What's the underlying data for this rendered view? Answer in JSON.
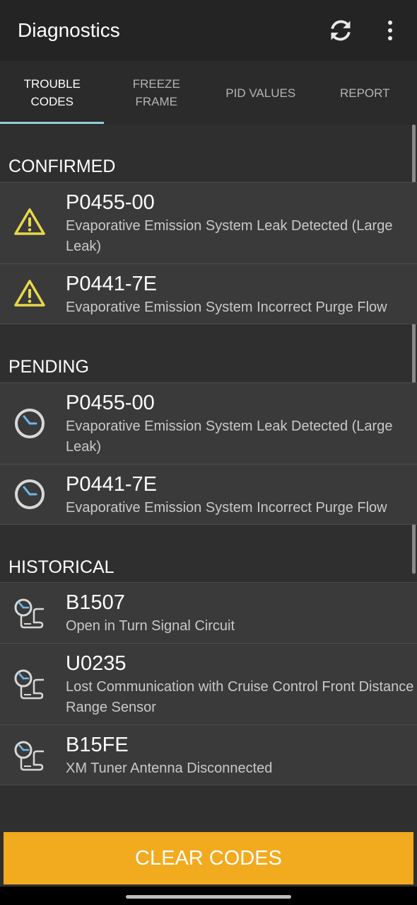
{
  "appbar": {
    "title": "Diagnostics",
    "refresh_icon": "refresh-icon",
    "more_icon": "more-vert-icon"
  },
  "tabs": [
    {
      "label": "TROUBLE\nCODES",
      "active": true
    },
    {
      "label": "FREEZE\nFRAME",
      "active": false
    },
    {
      "label": "PID VALUES",
      "active": false
    },
    {
      "label": "REPORT",
      "active": false
    }
  ],
  "sections": {
    "confirmed": {
      "title": "CONFIRMED",
      "items": [
        {
          "code": "P0455-00",
          "desc": "Evaporative Emission System Leak Detected (Large Leak)",
          "icon": "warning-icon"
        },
        {
          "code": "P0441-7E",
          "desc": "Evaporative Emission System Incorrect Purge Flow",
          "icon": "warning-icon"
        }
      ]
    },
    "pending": {
      "title": "PENDING",
      "items": [
        {
          "code": "P0455-00",
          "desc": "Evaporative Emission System Leak Detected (Large Leak)",
          "icon": "clock-icon"
        },
        {
          "code": "P0441-7E",
          "desc": "Evaporative Emission System Incorrect Purge Flow",
          "icon": "clock-icon"
        }
      ]
    },
    "historical": {
      "title": "HISTORICAL",
      "items": [
        {
          "code": "B1507",
          "desc": "Open in Turn Signal Circuit",
          "icon": "history-scroll-icon"
        },
        {
          "code": "U0235",
          "desc": "Lost Communication with Cruise Control Front Distance Range Sensor",
          "icon": "history-scroll-icon"
        },
        {
          "code": "B15FE",
          "desc": "XM Tuner Antenna Disconnected",
          "icon": "history-scroll-icon"
        }
      ]
    }
  },
  "clear_button": {
    "label": "CLEAR CODES"
  },
  "colors": {
    "accent": "#f2aa1f",
    "tab_indicator": "#8fd0d8",
    "warning": "#e8d84a",
    "clock_hand": "#6fb6e8"
  }
}
